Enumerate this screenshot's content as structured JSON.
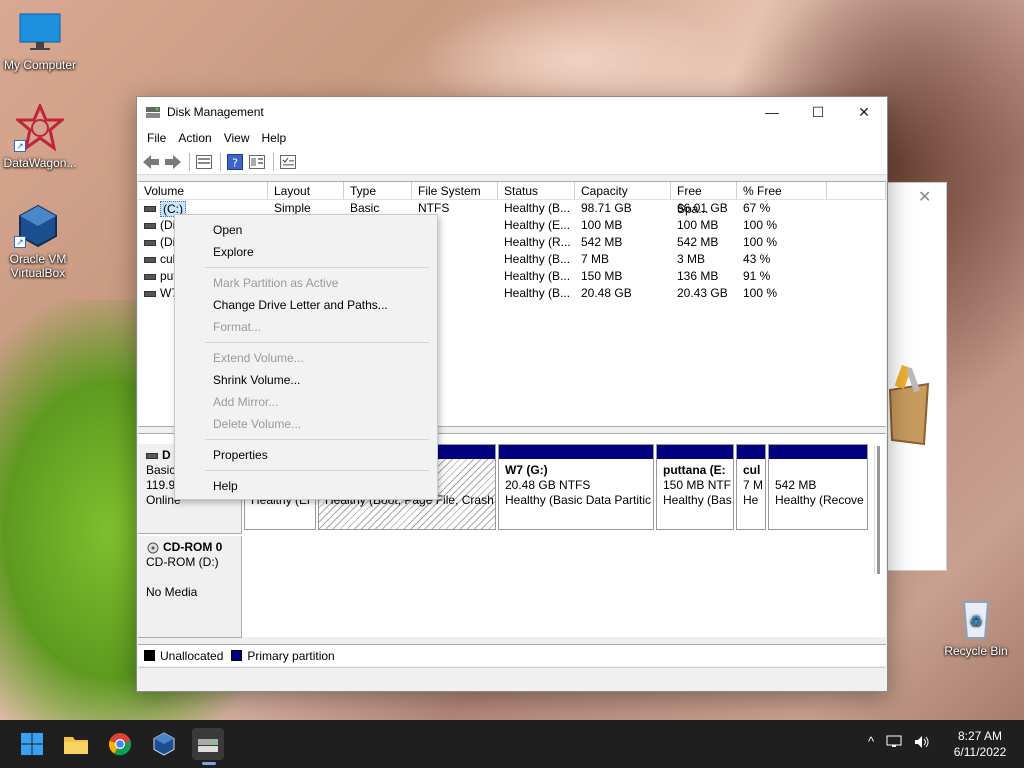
{
  "desktop": {
    "icons": [
      {
        "label": "My Computer",
        "icon": "monitor-icon"
      },
      {
        "label": "DataWagon...",
        "icon": "datawagon-icon"
      },
      {
        "label": "Oracle VM VirtualBox",
        "icon": "virtualbox-icon"
      },
      {
        "label": "Recycle Bin",
        "icon": "recycle-bin-icon"
      }
    ]
  },
  "window": {
    "title": "Disk Management",
    "controls": {
      "minimize": "—",
      "maximize": "☐",
      "close": "✕"
    }
  },
  "menu": [
    "File",
    "Action",
    "View",
    "Help"
  ],
  "volume_list": {
    "columns": [
      "Volume",
      "Layout",
      "Type",
      "File System",
      "Status",
      "Capacity",
      "Free Spa...",
      "% Free"
    ],
    "rows": [
      {
        "volume": "(C:)",
        "layout": "Simple",
        "type": "Basic",
        "fs": "NTFS",
        "status": "Healthy (B...",
        "capacity": "98.71 GB",
        "free": "66.01 GB",
        "pct": "67 %"
      },
      {
        "volume": "(Di",
        "layout": "",
        "type": "",
        "fs": "",
        "status": "Healthy (E...",
        "capacity": "100 MB",
        "free": "100 MB",
        "pct": "100 %"
      },
      {
        "volume": "(Di",
        "layout": "",
        "type": "",
        "fs": "",
        "status": "Healthy (R...",
        "capacity": "542 MB",
        "free": "542 MB",
        "pct": "100 %"
      },
      {
        "volume": "cul",
        "layout": "",
        "type": "",
        "fs": "S",
        "status": "Healthy (B...",
        "capacity": "7 MB",
        "free": "3 MB",
        "pct": "43 %"
      },
      {
        "volume": "put",
        "layout": "",
        "type": "",
        "fs": "S",
        "status": "Healthy (B...",
        "capacity": "150 MB",
        "free": "136 MB",
        "pct": "91 %"
      },
      {
        "volume": "W7",
        "layout": "",
        "type": "",
        "fs": "S",
        "status": "Healthy (B...",
        "capacity": "20.48 GB",
        "free": "20.43 GB",
        "pct": "100 %"
      }
    ]
  },
  "context_menu": {
    "items": [
      {
        "label": "Open",
        "enabled": true
      },
      {
        "label": "Explore",
        "enabled": true
      },
      {
        "label": "Mark Partition as Active",
        "enabled": false
      },
      {
        "label": "Change Drive Letter and Paths...",
        "enabled": true
      },
      {
        "label": "Format...",
        "enabled": false
      },
      {
        "label": "Extend Volume...",
        "enabled": false
      },
      {
        "label": "Shrink Volume...",
        "enabled": true
      },
      {
        "label": "Add Mirror...",
        "enabled": false
      },
      {
        "label": "Delete Volume...",
        "enabled": false
      },
      {
        "label": "Properties",
        "enabled": true
      },
      {
        "label": "Help",
        "enabled": true
      }
    ]
  },
  "disk0": {
    "name": "D",
    "type": "Basic",
    "size": "119.9",
    "state": "Online",
    "partitions": [
      {
        "line1": "",
        "line2": "",
        "line3": "Healthy (Er"
      },
      {
        "line1": "",
        "line2": "",
        "line3": "Healthy (Boot, Page File, Crash"
      },
      {
        "line1": "W7  (G:)",
        "line2": "20.48 GB NTFS",
        "line3": "Healthy (Basic Data Partitic"
      },
      {
        "line1": "puttana  (E:",
        "line2": "150 MB NTF",
        "line3": "Healthy (Bas"
      },
      {
        "line1": "cul",
        "line2": "7 M",
        "line3": "He"
      },
      {
        "line1": "",
        "line2": "542 MB",
        "line3": "Healthy (Recove"
      }
    ]
  },
  "cdrom": {
    "name": "CD-ROM 0",
    "type": "CD-ROM (D:)",
    "media": "No Media"
  },
  "legend": [
    {
      "label": "Unallocated",
      "color": "#000000"
    },
    {
      "label": "Primary partition",
      "color": "#000080"
    }
  ],
  "taskbar": {
    "time": "8:27 AM",
    "date": "6/11/2022",
    "tray_chevron": "^"
  }
}
